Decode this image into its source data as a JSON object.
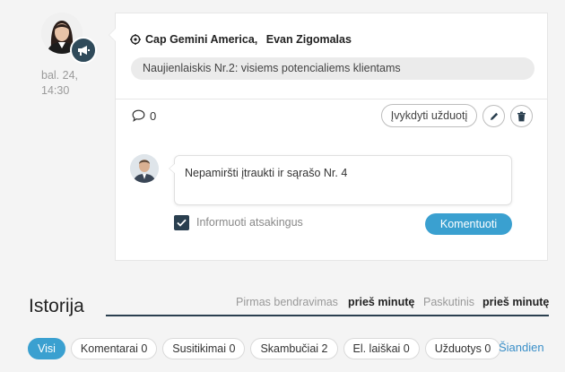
{
  "post": {
    "timestamp": "bal. 24, 14:30",
    "company": "Cap Gemini America,",
    "contact": "Evan Zigomalas",
    "subject": "Naujienlaiskis Nr.2: visiems potencialiems klientams",
    "comment_count": "0",
    "complete_task_label": "Įvykdyti užduotį"
  },
  "comment": {
    "text": "Nepamiršti įtraukti ir sąrašo Nr. 4",
    "notify_label": "Informuoti atsakingus",
    "notify_checked": true,
    "submit_label": "Komentuoti"
  },
  "history": {
    "title": "Istorija",
    "first_label": "Pirmas bendravimas",
    "first_value": "prieš minutę",
    "last_label": "Paskutinis",
    "last_value": "prieš minutę",
    "filters": [
      {
        "label": "Visi",
        "active": true
      },
      {
        "label": "Komentarai 0",
        "active": false
      },
      {
        "label": "Susitikimai 0",
        "active": false
      },
      {
        "label": "Skambučiai 2",
        "active": false
      },
      {
        "label": "El. laiškai 0",
        "active": false
      },
      {
        "label": "Užduotys 0",
        "active": false
      }
    ],
    "today_label": "Šiandien"
  },
  "colors": {
    "accent": "#3aa0d0",
    "dark": "#2a3f4f"
  }
}
